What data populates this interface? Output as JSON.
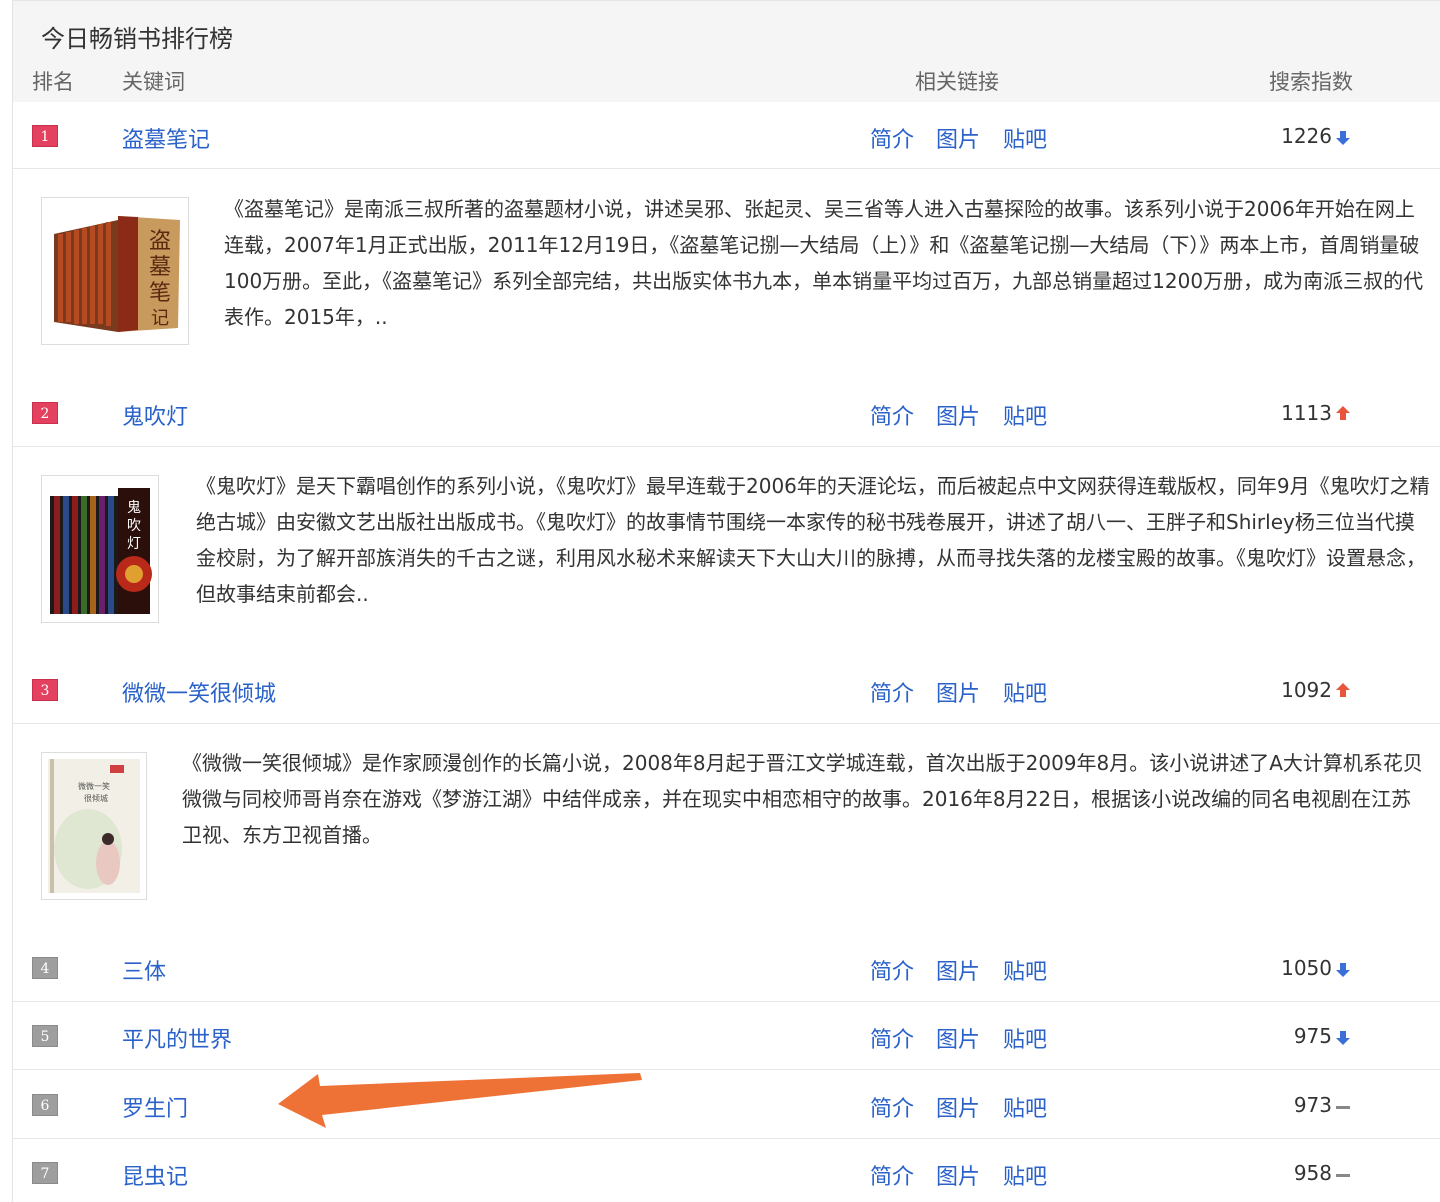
{
  "title": "今日畅销书排行榜",
  "columns": {
    "rank": "排名",
    "keyword": "关键词",
    "links": "相关链接",
    "index": "搜索指数"
  },
  "link_labels": {
    "intro": "简介",
    "images": "图片",
    "tieba": "贴吧"
  },
  "rows": [
    {
      "rank": "1",
      "keyword": "盗墓笔记",
      "index": "1226",
      "trend": "down",
      "description": "《盗墓笔记》是南派三叔所著的盗墓题材小说，讲述吴邪、张起灵、吴三省等人进入古墓探险的故事。该系列小说于2006年开始在网上连载，2007年1月正式出版，2011年12月19日，《盗墓笔记捌—大结局（上）》和《盗墓笔记捌—大结局（下）》两本上市，首周销量破100万册。至此，《盗墓笔记》系列全部完结，共出版实体书九本，单本销量平均过百万，九部总销量超过1200万册，成为南派三叔的代表作。2015年，.."
    },
    {
      "rank": "2",
      "keyword": "鬼吹灯",
      "index": "1113",
      "trend": "up",
      "description": "《鬼吹灯》是天下霸唱创作的系列小说，《鬼吹灯》最早连载于2006年的天涯论坛，而后被起点中文网获得连载版权，同年9月《鬼吹灯之精绝古城》由安徽文艺出版社出版成书。《鬼吹灯》的故事情节围绕一本家传的秘书残卷展开，讲述了胡八一、王胖子和Shirley杨三位当代摸金校尉，为了解开部族消失的千古之谜，利用风水秘术来解读天下大山大川的脉搏，从而寻找失落的龙楼宝殿的故事。《鬼吹灯》设置悬念，但故事结束前都会.."
    },
    {
      "rank": "3",
      "keyword": "微微一笑很倾城",
      "index": "1092",
      "trend": "up",
      "description": "《微微一笑很倾城》是作家顾漫创作的长篇小说，2008年8月起于晋江文学城连载，首次出版于2009年8月。该小说讲述了A大计算机系花贝微微与同校师哥肖奈在游戏《梦游江湖》中结伴成亲，并在现实中相恋相守的故事。2016年8月22日，根据该小说改编的同名电视剧在江苏卫视、东方卫视首播。"
    },
    {
      "rank": "4",
      "keyword": "三体",
      "index": "1050",
      "trend": "down"
    },
    {
      "rank": "5",
      "keyword": "平凡的世界",
      "index": "975",
      "trend": "down"
    },
    {
      "rank": "6",
      "keyword": "罗生门",
      "index": "973",
      "trend": "flat"
    },
    {
      "rank": "7",
      "keyword": "昆虫记",
      "index": "958",
      "trend": "flat"
    }
  ],
  "colors": {
    "link": "#2a62c9",
    "rank_hot": "#e4405f",
    "rank_normal": "#9e9e9e",
    "up": "#e8553a",
    "down": "#3a6fd8",
    "arrow": "#ee7236"
  }
}
